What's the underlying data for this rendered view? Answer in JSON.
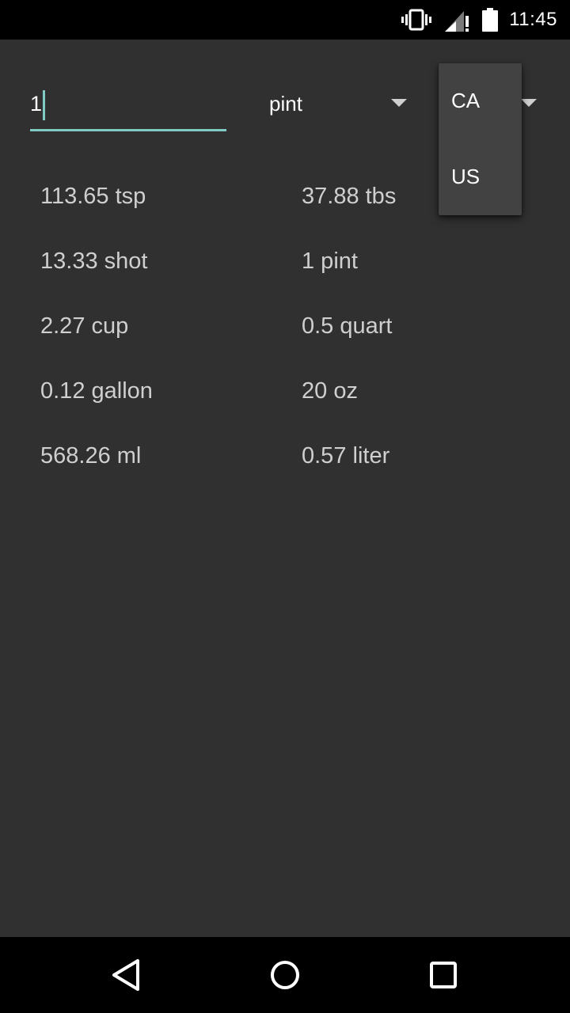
{
  "status_bar": {
    "time": "11:45",
    "icons": [
      "vibrate-icon",
      "signal-icon",
      "battery-icon"
    ]
  },
  "converter": {
    "input_value": "1",
    "unit_selected": "pint",
    "region_options": [
      "CA",
      "US"
    ],
    "accent_color": "#80cbc4"
  },
  "results": [
    {
      "left": "113.65 tsp",
      "right": "37.88 tbs"
    },
    {
      "left": "13.33 shot",
      "right": "1 pint"
    },
    {
      "left": "2.27 cup",
      "right": "0.5 quart"
    },
    {
      "left": "0.12 gallon",
      "right": "20 oz"
    },
    {
      "left": "568.26 ml",
      "right": "0.57 liter"
    }
  ],
  "nav_bar": {
    "icons": [
      "back-icon",
      "home-icon",
      "recents-icon"
    ]
  }
}
